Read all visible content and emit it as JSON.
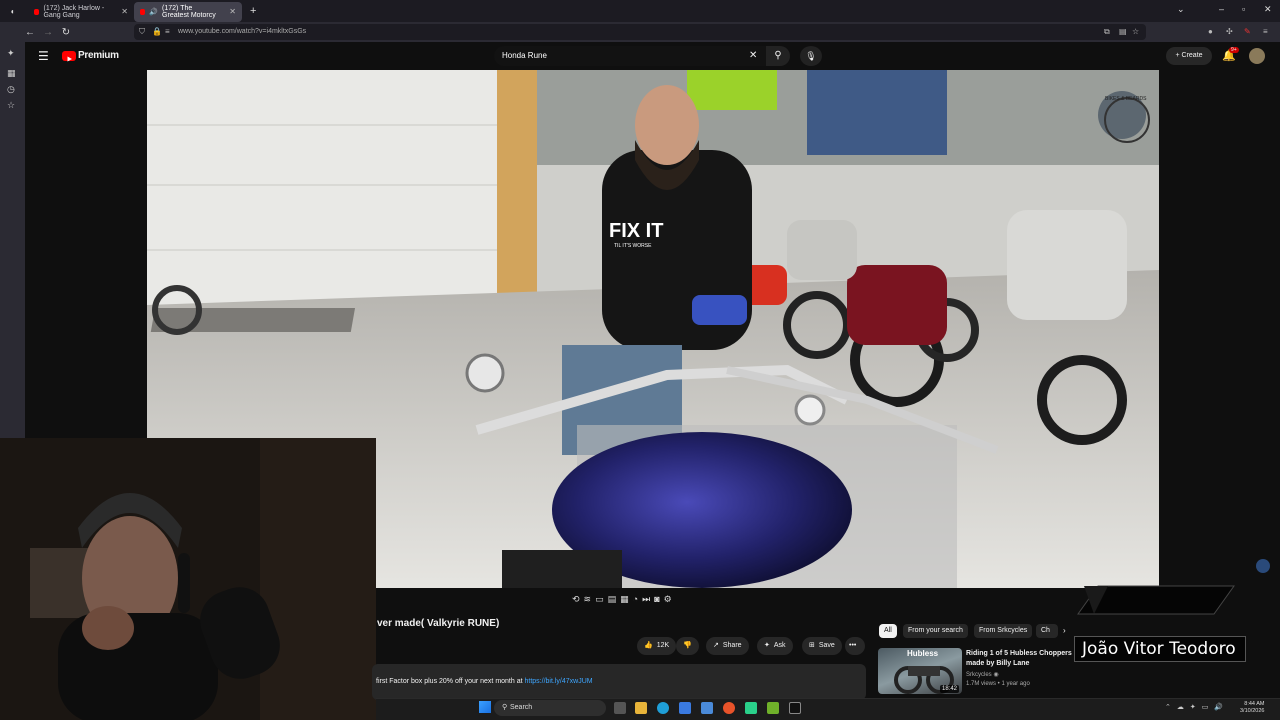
{
  "browser": {
    "tabs": [
      {
        "title": "(172) Jack Harlow - Gang Gang",
        "active": false
      },
      {
        "title": "(172) The Greatest Motorcy",
        "active": true
      }
    ],
    "new_tab": "+",
    "url": "www.youtube.com/watch?v=i4mkltxGsGs"
  },
  "youtube": {
    "logo": "Premium",
    "search_value": "Honda Rune",
    "create_label": "Create",
    "notifications_badge": "9+"
  },
  "video": {
    "title_visible": "ver made( Valkyrie RUNE)",
    "shirt_text": "FIX IT",
    "shirt_subtext": "TIL IT'S WORSE",
    "banner_brand": "BIKES & BEARDS"
  },
  "actions": {
    "like_count": "12K",
    "share": "Share",
    "ask": "Ask",
    "save": "Save",
    "more": "•••"
  },
  "description": {
    "text": "first Factor box plus 20% off your next month at ",
    "link": "https://bit.ly/47xwJUM"
  },
  "chips": [
    "All",
    "From your search",
    "From Srkcycles",
    "Ch"
  ],
  "recommendation": {
    "thumb_label": "Hubless",
    "duration": "18:42",
    "title": "Riding 1 of 5 Hubless Choppers made by Billy Lane",
    "channel": "Srkcycles",
    "meta": "1.7M views • 1 year ago"
  },
  "overlay": {
    "name": "João Vitor Teodoro"
  },
  "taskbar": {
    "search": "Search",
    "time": "8:44 AM",
    "date": "3/10/2026"
  },
  "colors": {
    "youtube_red": "#ff0000",
    "link_blue": "#3ea6ff",
    "bike_tank": "#2a2a7a"
  }
}
